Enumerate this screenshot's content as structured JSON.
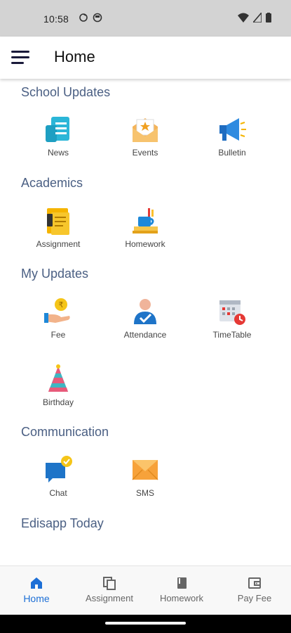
{
  "status_bar": {
    "time": "10:58"
  },
  "app_bar": {
    "title": "Home"
  },
  "sections": {
    "school_updates": {
      "title": "School Updates",
      "items": [
        {
          "label": "News"
        },
        {
          "label": "Events"
        },
        {
          "label": "Bulletin"
        }
      ]
    },
    "academics": {
      "title": "Academics",
      "items": [
        {
          "label": "Assignment"
        },
        {
          "label": "Homework"
        }
      ]
    },
    "my_updates": {
      "title": "My Updates",
      "items": [
        {
          "label": "Fee"
        },
        {
          "label": "Attendance"
        },
        {
          "label": "TimeTable"
        },
        {
          "label": "Birthday"
        }
      ]
    },
    "communication": {
      "title": "Communication",
      "items": [
        {
          "label": "Chat"
        },
        {
          "label": "SMS"
        }
      ]
    },
    "edisapp_today": {
      "title": "Edisapp Today"
    }
  },
  "bottom_nav": {
    "items": [
      {
        "label": "Home",
        "icon": "home-icon",
        "active": true
      },
      {
        "label": "Assignment",
        "icon": "copy-icon"
      },
      {
        "label": "Homework",
        "icon": "book-icon"
      },
      {
        "label": "Pay Fee",
        "icon": "wallet-icon"
      }
    ]
  },
  "colors": {
    "section_title": "#4a5f83",
    "active_nav": "#1d6fd6",
    "status_bar_bg": "#d3d3d3"
  }
}
